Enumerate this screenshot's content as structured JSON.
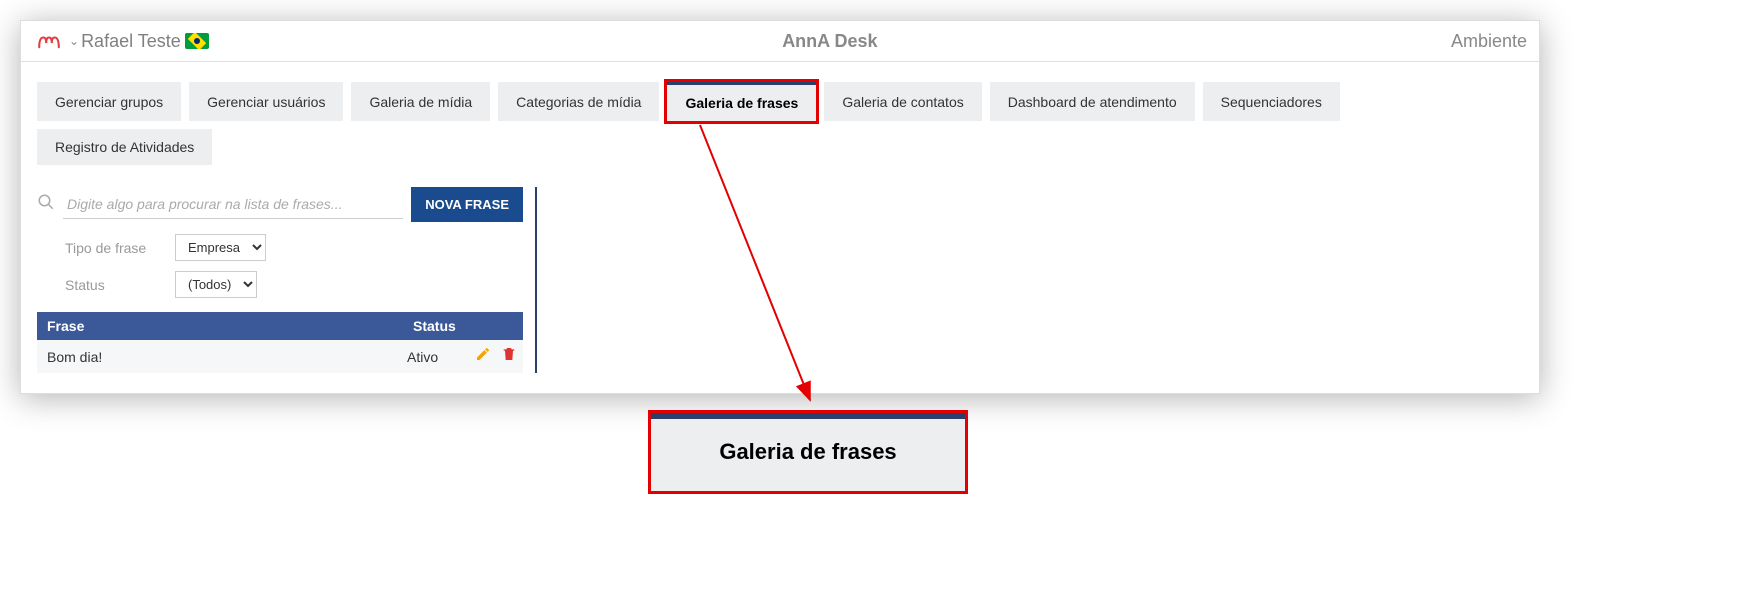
{
  "header": {
    "user_name": "Rafael Teste",
    "app_title": "AnnA Desk",
    "right_label": "Ambiente"
  },
  "tabs": [
    {
      "label": "Gerenciar grupos",
      "active": false
    },
    {
      "label": "Gerenciar usuários",
      "active": false
    },
    {
      "label": "Galeria de mídia",
      "active": false
    },
    {
      "label": "Categorias de mídia",
      "active": false
    },
    {
      "label": "Galeria de frases",
      "active": true
    },
    {
      "label": "Galeria de contatos",
      "active": false
    },
    {
      "label": "Dashboard de atendimento",
      "active": false
    },
    {
      "label": "Sequenciadores",
      "active": false
    },
    {
      "label": "Registro de Atividades",
      "active": false
    }
  ],
  "search": {
    "placeholder": "Digite algo para procurar na lista de frases...",
    "button_label": "NOVA FRASE"
  },
  "filters": {
    "tipo_label": "Tipo de frase",
    "tipo_value": "Empresa",
    "status_label": "Status",
    "status_value": "(Todos)"
  },
  "table": {
    "col_frase": "Frase",
    "col_status": "Status",
    "rows": [
      {
        "frase": "Bom dia!",
        "status": "Ativo"
      }
    ]
  },
  "callout": {
    "text": "Galeria de frases"
  }
}
